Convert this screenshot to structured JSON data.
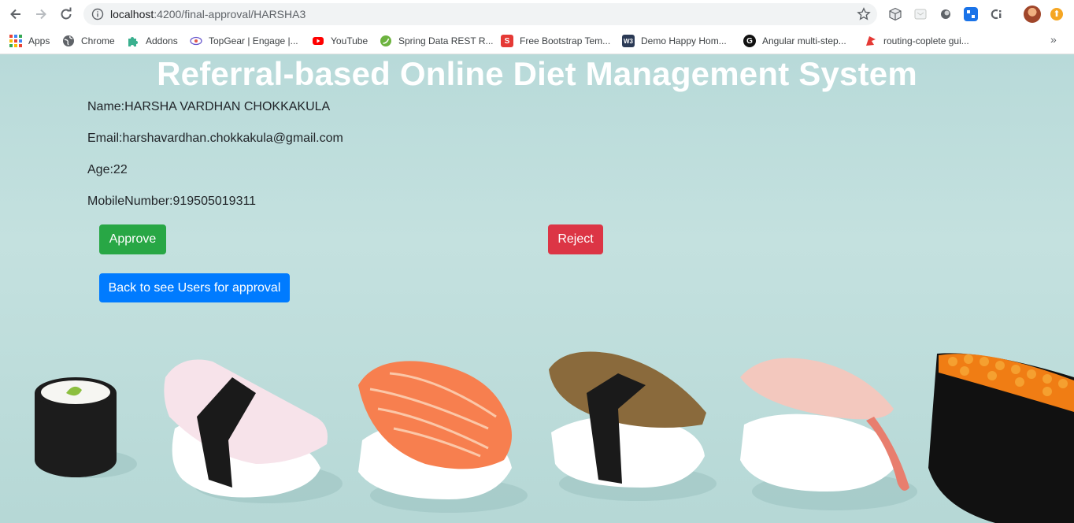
{
  "browser": {
    "url_host": "localhost",
    "url_rest": ":4200/final-approval/HARSHA3",
    "bookmarks": [
      {
        "label": "Apps",
        "icon": "apps-grid-icon"
      },
      {
        "label": "Chrome",
        "icon": "globe-icon"
      },
      {
        "label": "Addons",
        "icon": "puzzle-icon"
      },
      {
        "label": "TopGear | Engage |...",
        "icon": "topgear-icon"
      },
      {
        "label": "YouTube",
        "icon": "youtube-icon"
      },
      {
        "label": "Spring Data REST R...",
        "icon": "spring-icon"
      },
      {
        "label": "Free Bootstrap Tem...",
        "icon": "bootstrap-s-icon"
      },
      {
        "label": "Demo Happy Hom...",
        "icon": "w3-icon"
      },
      {
        "label": "Angular multi-step...",
        "icon": "g-icon"
      },
      {
        "label": "routing-coplete gui...",
        "icon": "flag-icon"
      }
    ],
    "more_label": "»",
    "update_badge": "⬆"
  },
  "page": {
    "title": "Referral-based Online Diet Management System",
    "fields": {
      "name": "Name:HARSHA VARDHAN CHOKKAKULA",
      "email": "Email:harshavardhan.chokkakula@gmail.com",
      "age": "Age:22",
      "mobile": "MobileNumber:919505019311"
    },
    "buttons": {
      "approve": "Approve",
      "reject": "Reject",
      "back": "Back to see Users for approval"
    },
    "colors": {
      "approve": "#28a745",
      "reject": "#dc3545",
      "back": "#007bff",
      "background": "#bcdcdc"
    }
  }
}
